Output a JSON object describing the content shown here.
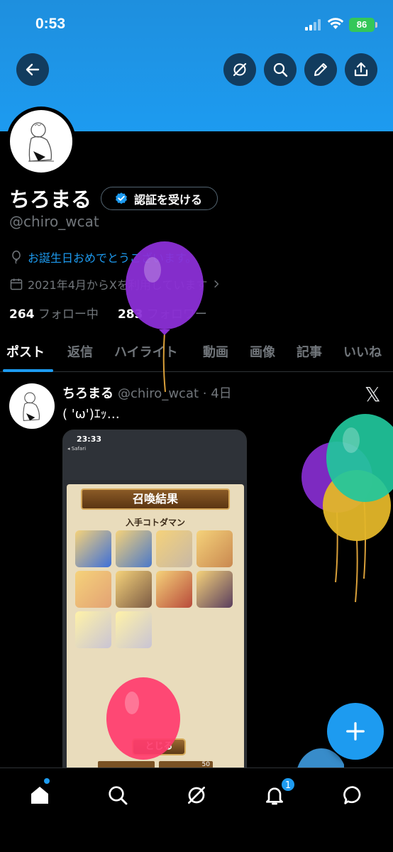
{
  "status_bar": {
    "time": "0:53",
    "battery": "86"
  },
  "profile": {
    "display_name": "ちろまる",
    "verify_label": "認証を受ける",
    "handle": "@chiro_wcat",
    "birthday_message": "お誕生日おめでとうございます。",
    "joined": "2021年4月からXを利用しています",
    "following_count": "264",
    "following_label": "フォロー中",
    "followers_count": "283",
    "followers_label": "フォロワー"
  },
  "tabs": [
    {
      "label": "ポスト",
      "active": true
    },
    {
      "label": "返信"
    },
    {
      "label": "ハイライト"
    },
    {
      "label": "動画"
    },
    {
      "label": "画像"
    },
    {
      "label": "記事"
    },
    {
      "label": "いいね"
    }
  ],
  "tweet": {
    "author": "ちろまる",
    "handle_time": "@chiro_wcat · 4日",
    "text": "( 'ω')ｴｯ…",
    "x_logo": "𝕏",
    "media": {
      "time": "23:33",
      "safari": "◂ Safari",
      "banner": "召喚結果",
      "subtitle": "入手コトダマン",
      "close_label": "とじる",
      "stat_value": "50"
    }
  },
  "nav": {
    "notification_count": "1"
  },
  "colors": {
    "accent": "#1d9bf0",
    "banner": "#1d9bf0"
  }
}
